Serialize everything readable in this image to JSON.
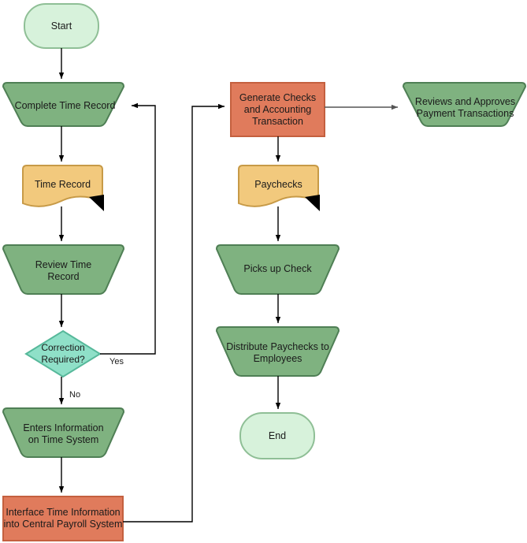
{
  "diagram": {
    "title": "Payroll Processing Flowchart",
    "background": "#ffffff",
    "colors": {
      "terminator_fill": "#d7f2db",
      "terminator_stroke": "#8fbf96",
      "process_green_fill": "#7fb280",
      "process_green_stroke": "#4f7f55",
      "document_fill": "#f2c97d",
      "document_stroke": "#c79a47",
      "system_red_fill": "#e07b5c",
      "system_red_stroke": "#c4603f",
      "decision_fill": "#8fe0c8",
      "decision_stroke": "#56b89a",
      "connector_black": "#000000",
      "connector_gray": "#555555"
    }
  },
  "nodes": [
    {
      "id": "start",
      "label": "Start",
      "shape": "terminator",
      "column": "left"
    },
    {
      "id": "complete_time_record",
      "label": "Complete Time Record",
      "shape": "trapezoid",
      "column": "left"
    },
    {
      "id": "time_record",
      "label": "Time Record",
      "shape": "document",
      "column": "left"
    },
    {
      "id": "review_time_record",
      "label": "Review Time\nRecord",
      "shape": "trapezoid",
      "column": "left"
    },
    {
      "id": "correction_required",
      "label": "Correction\nRequired?",
      "shape": "decision",
      "column": "left"
    },
    {
      "id": "enters_information",
      "label": "Enters Information\non Time System",
      "shape": "trapezoid",
      "column": "left"
    },
    {
      "id": "interface_time",
      "label": "Interface Time Information\ninto Central Payroll System",
      "shape": "rectangle",
      "column": "left"
    },
    {
      "id": "generate_checks",
      "label": "Generate Checks\nand Accounting\nTransaction",
      "shape": "rectangle",
      "column": "center"
    },
    {
      "id": "paychecks",
      "label": "Paychecks",
      "shape": "document",
      "column": "center"
    },
    {
      "id": "picks_up_check",
      "label": "Picks up Check",
      "shape": "trapezoid",
      "column": "center"
    },
    {
      "id": "distribute_paychecks",
      "label": "Distribute Paychecks to\nEmployees",
      "shape": "trapezoid",
      "column": "center"
    },
    {
      "id": "end",
      "label": "End",
      "shape": "terminator",
      "column": "center"
    },
    {
      "id": "reviews_approves",
      "label": "Reviews and Approves\nPayment Transactions",
      "shape": "trapezoid",
      "column": "right"
    }
  ],
  "node_text": {
    "start": "Start",
    "complete_time_record": "Complete Time Record",
    "time_record": "Time Record",
    "review_time_record_l1": "Review Time",
    "review_time_record_l2": "Record",
    "correction_required_l1": "Correction",
    "correction_required_l2": "Required?",
    "enters_information_l1": "Enters Information",
    "enters_information_l2": "on Time System",
    "interface_time_l1": "Interface Time Information",
    "interface_time_l2": "into Central Payroll System",
    "generate_checks_l1": "Generate Checks",
    "generate_checks_l2": "and Accounting",
    "generate_checks_l3": "Transaction",
    "paychecks": "Paychecks",
    "picks_up_check": "Picks up Check",
    "distribute_paychecks_l1": "Distribute Paychecks to",
    "distribute_paychecks_l2": "Employees",
    "end": "End",
    "reviews_approves_l1": "Reviews and Approves",
    "reviews_approves_l2": "Payment Transactions"
  },
  "edges": [
    {
      "id": "e1",
      "from": "start",
      "to": "complete_time_record",
      "label": ""
    },
    {
      "id": "e2",
      "from": "complete_time_record",
      "to": "time_record",
      "label": ""
    },
    {
      "id": "e3",
      "from": "time_record",
      "to": "review_time_record",
      "label": ""
    },
    {
      "id": "e4",
      "from": "review_time_record",
      "to": "correction_required",
      "label": ""
    },
    {
      "id": "e5",
      "from": "correction_required",
      "to": "complete_time_record",
      "label": "Yes"
    },
    {
      "id": "e6",
      "from": "correction_required",
      "to": "enters_information",
      "label": "No"
    },
    {
      "id": "e7",
      "from": "enters_information",
      "to": "interface_time",
      "label": ""
    },
    {
      "id": "e8",
      "from": "interface_time",
      "to": "generate_checks",
      "label": ""
    },
    {
      "id": "e9",
      "from": "generate_checks",
      "to": "reviews_approves",
      "label": ""
    },
    {
      "id": "e10",
      "from": "generate_checks",
      "to": "paychecks",
      "label": ""
    },
    {
      "id": "e11",
      "from": "paychecks",
      "to": "picks_up_check",
      "label": ""
    },
    {
      "id": "e12",
      "from": "picks_up_check",
      "to": "distribute_paychecks",
      "label": ""
    },
    {
      "id": "e13",
      "from": "distribute_paychecks",
      "to": "end",
      "label": ""
    }
  ],
  "edge_labels": {
    "yes": "Yes",
    "no": "No"
  }
}
